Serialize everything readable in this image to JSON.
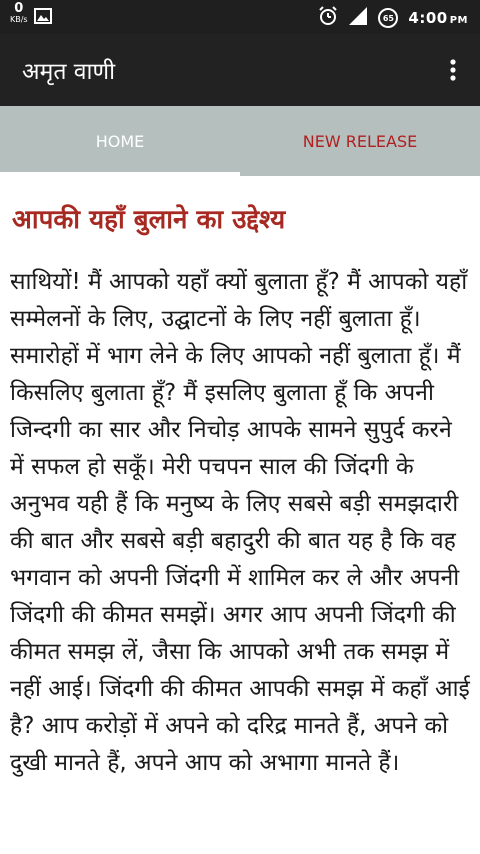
{
  "status_bar": {
    "data_rate": "0",
    "data_unit": "KB/s",
    "battery": "65",
    "time": "4:00",
    "ampm": "PM",
    "icons": [
      "image-icon",
      "alarm-icon",
      "signal-icon",
      "battery-icon"
    ]
  },
  "app_bar": {
    "title": "अमृत वाणी",
    "menu_icon": "more-vert-icon"
  },
  "tabs": [
    {
      "label": "HOME",
      "selected": true
    },
    {
      "label": "NEW RELEASE",
      "selected": false
    }
  ],
  "article": {
    "heading": "आपकी यहाँ बुलाने का उद्देश्य",
    "body": "साथियों! मैं आपको यहाँ क्यों बुलाता हूँ? मैं आपको यहाँ सम्मेलनों के लिए, उद्घाटनों के लिए नहीं बुलाता हूँ। समारोहों में भाग लेने के लिए आपको नहीं बुलाता हूँ। मैं किसलिए बुलाता हूँ? मैं इसलिए बुलाता हूँ कि अपनी जिन्दगी का सार और निचोड़ आपके सामने सुपुर्द करने में सफल हो सकूँ। मेरी पचपन साल की जिंदगी के अनुभव यही हैं कि मनुष्य के लिए सबसे बड़ी समझदारी की बात और सबसे बड़ी बहादुरी की बात यह है कि वह भगवान को अपनी जिंदगी में शामिल कर ले और अपनी जिंदगी की कीमत समझें। अगर आप अपनी जिंदगी की कीमत समझ लें, जैसा कि आपको अभी तक समझ में नहीं आई। जिंदगी की कीमत आपकी समझ में कहाँ आई है? आप करोड़ों में अपने को दरिद्र मानते हैं, अपने को दुखी मानते हैं, अपने आप को अभागा मानते हैं।"
  },
  "colors": {
    "status_bar": "#1f1f1f",
    "app_bar": "#222222",
    "tab_bar": "#b4bfbe",
    "heading": "#a62a22",
    "tab_inactive_text": "#b02020"
  }
}
